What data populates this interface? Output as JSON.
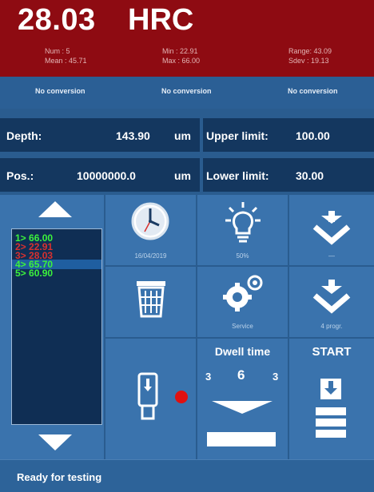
{
  "header": {
    "value": "28.03",
    "unit": "HRC",
    "stats": {
      "num": "Num : 5",
      "mean": "Mean : 45.71",
      "min": "Min : 22.91",
      "max": "Max : 66.00",
      "range": "Range: 43.09",
      "sdev": "Sdev : 19.13"
    },
    "conversions": [
      "No conversion",
      "No conversion",
      "No conversion"
    ]
  },
  "info": {
    "depth_label": "Depth:",
    "depth_value": "143.90",
    "depth_unit": "um",
    "upper_label": "Upper limit:",
    "upper_value": "100.00",
    "pos_label": "Pos.:",
    "pos_value": "10000000.0",
    "pos_unit": "um",
    "lower_label": "Lower limit:",
    "lower_value": "30.00"
  },
  "results": [
    {
      "text": "1> 66.00",
      "color": "#3cf23c"
    },
    {
      "text": "2> 22.91",
      "color": "#d8312f"
    },
    {
      "text": "3> 28.03",
      "color": "#d8312f"
    },
    {
      "text": "4> 65.70",
      "color": "#3cf23c"
    },
    {
      "text": "5> 60.90",
      "color": "#3cf23c"
    }
  ],
  "tiles": {
    "clock_caption": "16/04/2019",
    "light_caption": "50%",
    "settings_caption": "Service",
    "load_caption": "4 progr."
  },
  "dwell": {
    "label": "Dwell time",
    "left": "3",
    "center": "6",
    "right": "3"
  },
  "start": {
    "label": "START"
  },
  "status": {
    "text": "Ready for testing"
  },
  "colors": {
    "header_bg": "#8e0b12",
    "panel_bg": "#2a5c8f",
    "tile_bg": "#3a73ad",
    "indicator": "#e01010"
  }
}
